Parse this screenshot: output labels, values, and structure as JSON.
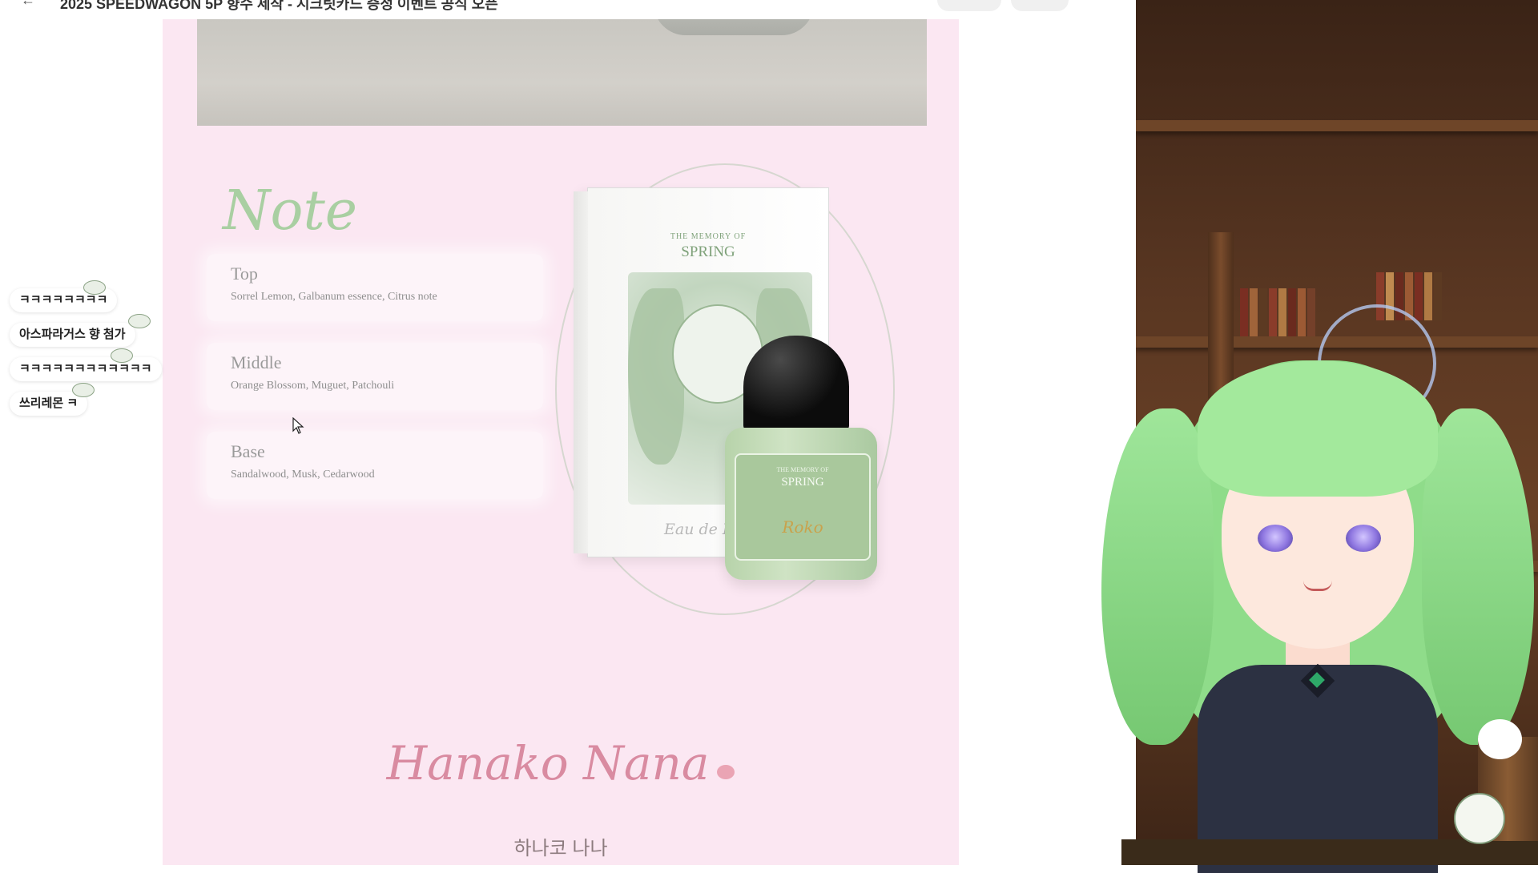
{
  "browser": {
    "title": "2025 SPEEDWAGON 5P 향수 제작 - 시크릿카드 증정 이벤트 공식 오픈",
    "back_icon": "arrow-left-icon"
  },
  "product": {
    "note_title": "Note",
    "notes": [
      {
        "label": "Top",
        "desc": "Sorrel Lemon, Galbanum essence, Citrus note"
      },
      {
        "label": "Middle",
        "desc": "Orange Blossom, Muguet, Patchouli"
      },
      {
        "label": "Base",
        "desc": "Sandalwood, Musk, Cedarwood"
      }
    ],
    "box_brand_small": "THE MEMORY OF",
    "box_brand_large": "SPRING",
    "box_script": "Eau de Parfum",
    "bottle_brand_small": "THE MEMORY OF",
    "bottle_brand_large": "SPRING",
    "bottle_signature": "Roko",
    "artist_signature": "Hanako Nana",
    "artist_name_korean": "하나코 나나"
  },
  "chat": {
    "messages": [
      {
        "text": "ㅋㅋㅋㅋㅋㅋㅋㅋ"
      },
      {
        "text": "아스파라거스 향 첨가"
      },
      {
        "text": "ㅋㅋㅋㅋㅋㅋㅋㅋㅋㅋㅋㅋ"
      },
      {
        "text": "쓰리레몬 ㅋ"
      }
    ],
    "sticker_icon": "mascot-sticker-icon"
  },
  "colors": {
    "page_background": "#fbe7f2",
    "note_green": "#a9cfa2",
    "signature_pink": "#d98ba1"
  }
}
